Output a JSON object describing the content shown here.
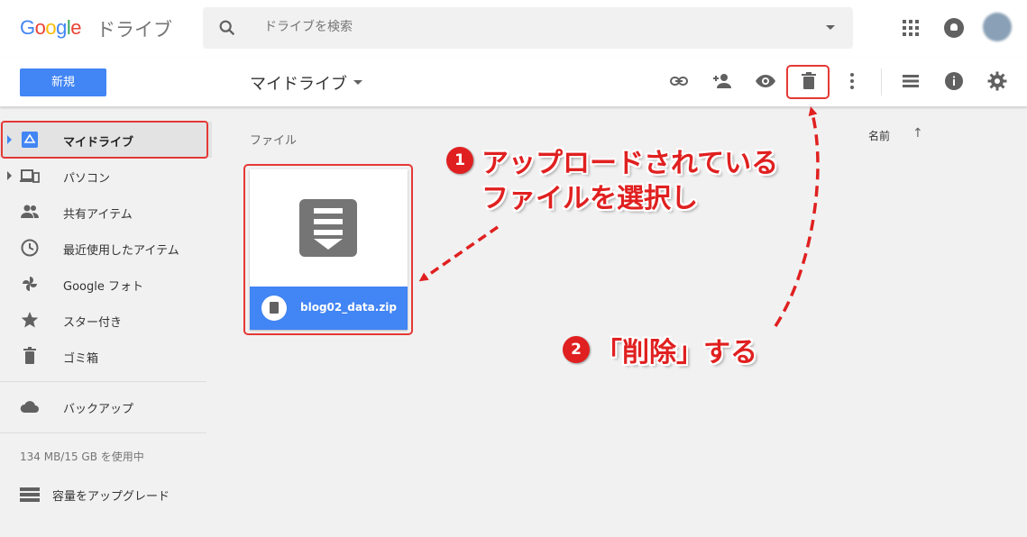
{
  "app": {
    "logo_text": "Google",
    "logo_suffix": "ドライブ"
  },
  "search": {
    "placeholder": "ドライブを検索"
  },
  "toolbar": {
    "new_label": "新規",
    "title": "マイドライブ",
    "icons": [
      "link-icon",
      "add-person-icon",
      "eye-icon",
      "trash-icon",
      "more-vert-icon",
      "list-view-icon",
      "info-icon",
      "settings-icon"
    ]
  },
  "sidebar": {
    "items": [
      {
        "label": "マイドライブ",
        "icon": "drive-icon",
        "active": true
      },
      {
        "label": "パソコン",
        "icon": "computers-icon"
      },
      {
        "label": "共有アイテム",
        "icon": "shared-icon"
      },
      {
        "label": "最近使用したアイテム",
        "icon": "clock-icon"
      },
      {
        "label": "Google フォト",
        "icon": "photos-icon"
      },
      {
        "label": "スター付き",
        "icon": "star-icon"
      },
      {
        "label": "ゴミ箱",
        "icon": "trash-icon"
      },
      {
        "label": "バックアップ",
        "icon": "cloud-icon"
      }
    ],
    "storage_text": "134 MB/15 GB を使用中",
    "upgrade_label": "容量をアップグレード"
  },
  "main": {
    "section_label": "ファイル",
    "sort_label": "名前",
    "sort_arrow": "↑",
    "file": {
      "name": "blog02_data.zip"
    }
  },
  "annotations": [
    {
      "number": "1",
      "lines": [
        "アップロードされている",
        "ファイルを選択し"
      ]
    },
    {
      "number": "2",
      "text": "「削除」する"
    }
  ],
  "colors": {
    "accent": "#4285f4",
    "annotation_red": "#e02020"
  }
}
